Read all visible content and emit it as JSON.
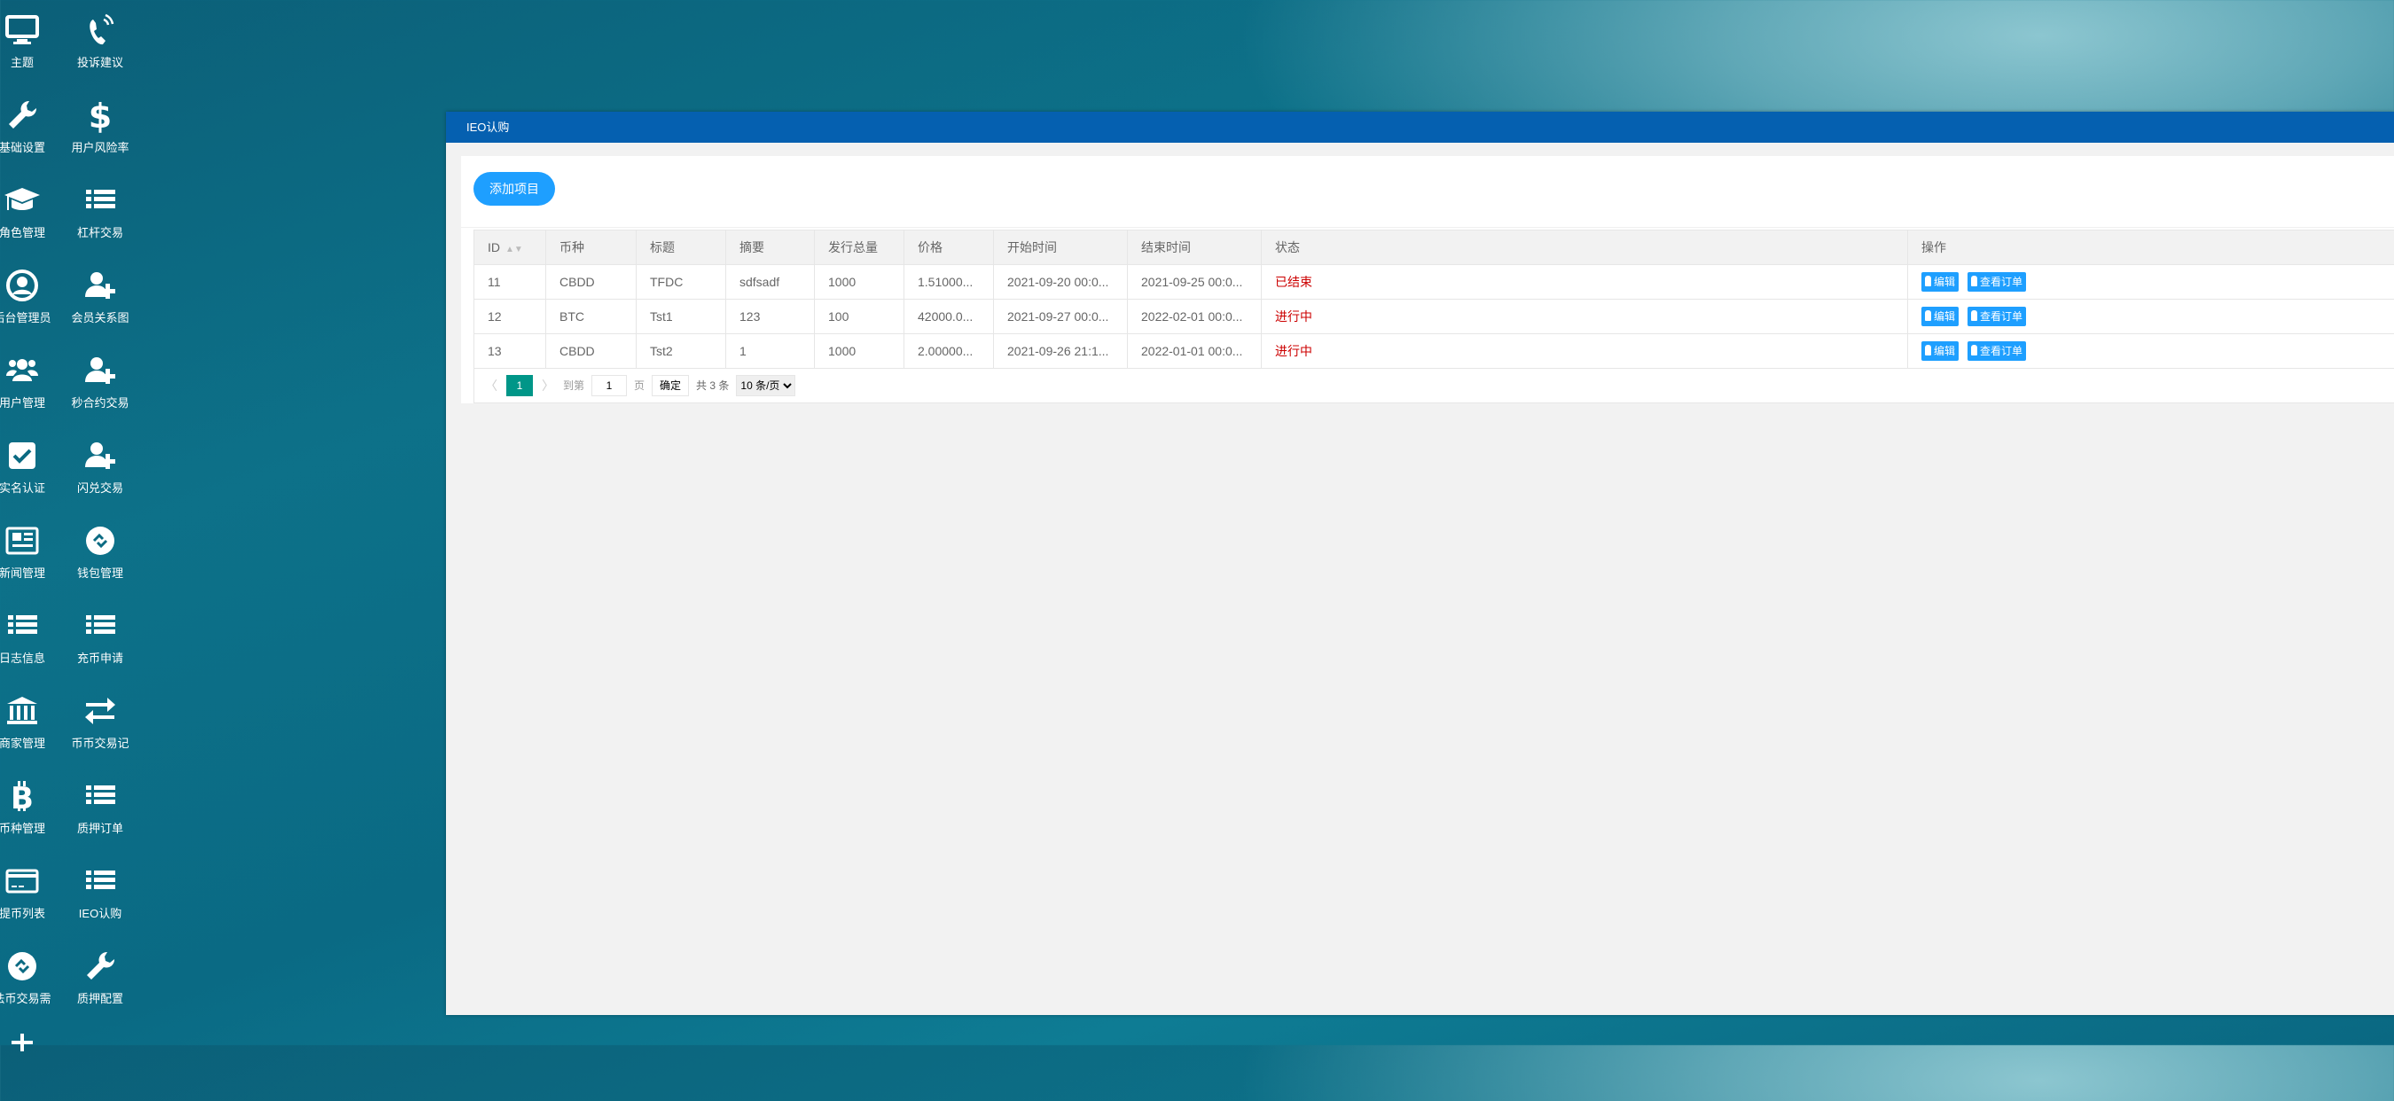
{
  "sidebar": {
    "items": [
      {
        "label": "主题",
        "icon": "monitor-icon"
      },
      {
        "label": "投诉建议",
        "icon": "phone-icon"
      },
      {
        "label": "基础设置",
        "icon": "wrench-icon"
      },
      {
        "label": "用户风险率",
        "icon": "dollar-icon"
      },
      {
        "label": "角色管理",
        "icon": "graduation-cap-icon"
      },
      {
        "label": "杠杆交易",
        "icon": "list-icon"
      },
      {
        "label": "后台管理员",
        "icon": "user-circle-icon"
      },
      {
        "label": "会员关系图",
        "icon": "user-plus-icon"
      },
      {
        "label": "用户管理",
        "icon": "users-icon"
      },
      {
        "label": "秒合约交易",
        "icon": "user-plus-icon"
      },
      {
        "label": "实名认证",
        "icon": "check-square-icon"
      },
      {
        "label": "闪兑交易",
        "icon": "user-plus-icon"
      },
      {
        "label": "新闻管理",
        "icon": "newspaper-icon"
      },
      {
        "label": "钱包管理",
        "icon": "link-circle-icon"
      },
      {
        "label": "日志信息",
        "icon": "list-icon"
      },
      {
        "label": "充币申请",
        "icon": "list-icon"
      },
      {
        "label": "商家管理",
        "icon": "bank-icon"
      },
      {
        "label": "币币交易记",
        "icon": "exchange-icon"
      },
      {
        "label": "币种管理",
        "icon": "bitcoin-icon"
      },
      {
        "label": "质押订单",
        "icon": "list-icon"
      },
      {
        "label": "提币列表",
        "icon": "credit-card-icon"
      },
      {
        "label": "IEO认购",
        "icon": "list-icon"
      },
      {
        "label": "法币交易需",
        "icon": "link-circle-icon"
      },
      {
        "label": "质押配置",
        "icon": "wrench-icon"
      }
    ]
  },
  "panel": {
    "title": "IEO认购"
  },
  "toolbar": {
    "add_label": "添加项目"
  },
  "table": {
    "headers": [
      "ID",
      "币种",
      "标题",
      "摘要",
      "发行总量",
      "价格",
      "开始时间",
      "结束时间",
      "状态",
      "操作"
    ],
    "rows": [
      {
        "id": "11",
        "coin": "CBDD",
        "title": "TFDC",
        "summary": "sdfsadf",
        "total": "1000",
        "price": "1.51000...",
        "start": "2021-09-20 00:0...",
        "end": "2021-09-25 00:0...",
        "status": "已结束"
      },
      {
        "id": "12",
        "coin": "BTC",
        "title": "Tst1",
        "summary": "123",
        "total": "100",
        "price": "42000.0...",
        "start": "2021-09-27 00:0...",
        "end": "2022-02-01 00:0...",
        "status": "进行中"
      },
      {
        "id": "13",
        "coin": "CBDD",
        "title": "Tst2",
        "summary": "1",
        "total": "1000",
        "price": "2.00000...",
        "start": "2021-09-26 21:1...",
        "end": "2022-01-01 00:0...",
        "status": "进行中"
      }
    ],
    "edit_label": "编辑",
    "orders_label": "查看订单"
  },
  "pager": {
    "prev": "〈",
    "current": "1",
    "next": "〉",
    "goto_label": "到第",
    "page_value": "1",
    "page_unit": "页",
    "confirm": "确定",
    "total": "共 3 条",
    "page_size": "10 条/页"
  },
  "colors": {
    "header": "#0560b0",
    "accent": "#1e9fff",
    "pager_active": "#009688",
    "status": "#cc0000"
  }
}
